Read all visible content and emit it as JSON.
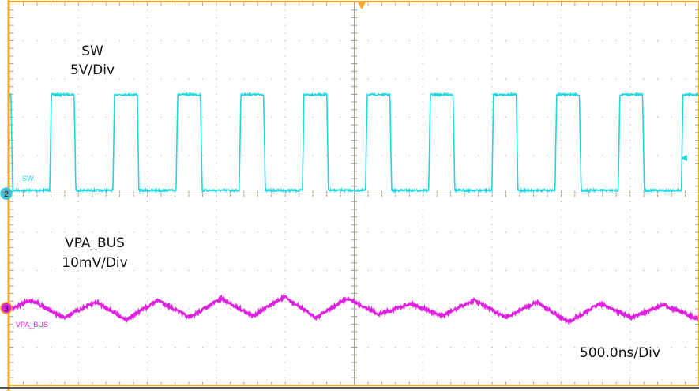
{
  "chart_data": {
    "type": "line",
    "title": "",
    "grid": true,
    "x_divisions": 10,
    "y_divisions": 10,
    "time_per_div_label": "500.0ns/Div",
    "time_per_div_ns": 500,
    "xlim_ns": [
      0,
      5000
    ],
    "frame_color": "#f5a623",
    "series": [
      {
        "name": "SW",
        "channel": "2",
        "scale_label": "5V/Div",
        "volts_per_div": 5,
        "color": "#1ed8e0",
        "waveform": "square",
        "period_ns": 458,
        "first_rise_ns": 292,
        "high_ns": 165,
        "edge_ns": 12,
        "low_V": 0,
        "high_V": 12.5
      },
      {
        "name": "VPA_BUS",
        "channel": "3",
        "scale_label": "10mV/Div",
        "mv_per_div": 10,
        "color": "#e020e0",
        "t_ns": [
          0,
          160,
          389,
          630,
          848,
          1077,
          1306,
          1535,
          1764,
          1993,
          2222,
          2451,
          2680,
          2909,
          3138,
          3367,
          3596,
          3825,
          4054,
          4283,
          4512,
          4741,
          5000
        ],
        "values_mV": [
          -0.4,
          2.1,
          -2.5,
          1.6,
          -3.1,
          2.1,
          -2.5,
          2.5,
          -2.1,
          2.9,
          -2.5,
          2.5,
          -1.6,
          1.2,
          -2.1,
          2.1,
          -2.5,
          1.6,
          -3.7,
          1.2,
          -2.5,
          0.8,
          -2.9
        ]
      }
    ]
  },
  "annotations": {
    "sw_name": "SW",
    "sw_scale": "5V/Div",
    "vpa_name": "VPA_BUS",
    "vpa_scale": "10mV/Div",
    "timebase": "500.0ns/Div"
  },
  "markers": {
    "ch2": "2",
    "ch3": "3",
    "sw_label": "SW",
    "vpa_label": "VPA_BUS"
  }
}
